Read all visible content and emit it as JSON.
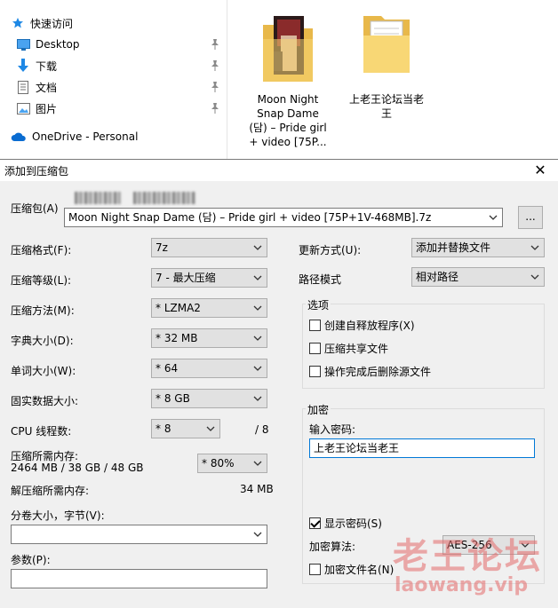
{
  "explorer": {
    "nav": [
      {
        "label": "快速访问",
        "icon": "star-icon"
      },
      {
        "label": "Desktop",
        "icon": "desktop-icon"
      },
      {
        "label": "下载",
        "icon": "download-icon"
      },
      {
        "label": "文档",
        "icon": "document-icon"
      },
      {
        "label": "图片",
        "icon": "picture-icon"
      },
      {
        "label": "OneDrive - Personal",
        "icon": "cloud-icon"
      }
    ],
    "files": [
      {
        "name": "Moon Night Snap  Dame (담) – Pride girl + video [75P...",
        "icon": "folder-with-photo-icon"
      },
      {
        "name": "上老王论坛当老王",
        "icon": "folder-icon"
      }
    ]
  },
  "dialog": {
    "title": "添加到压缩包",
    "archive_label": "压缩包(A)",
    "archive_value": "Moon Night Snap  Dame (담) – Pride girl + video [75P+1V-468MB].7z",
    "browse_label": "...",
    "left": [
      {
        "label": "压缩格式(F):",
        "value": "7z"
      },
      {
        "label": "压缩等级(L):",
        "value": "7 - 最大压缩"
      },
      {
        "label": "压缩方法(M):",
        "value": "* LZMA2"
      },
      {
        "label": "字典大小(D):",
        "value": "* 32 MB"
      },
      {
        "label": "单词大小(W):",
        "value": "* 64"
      },
      {
        "label": "固实数据大小:",
        "value": "* 8 GB"
      }
    ],
    "cpu_label": "CPU 线程数:",
    "cpu_value": "* 8",
    "cpu_max": "/ 8",
    "mem_label": "压缩所需内存:",
    "mem_detail": "2464 MB / 38 GB / 48 GB",
    "mem_value": "* 80%",
    "decomp_label": "解压缩所需内存:",
    "decomp_value": "34 MB",
    "volume_label": "分卷大小，字节(V):",
    "volume_value": "",
    "params_label": "参数(P):",
    "params_value": "",
    "update_label": "更新方式(U):",
    "update_value": "添加并替换文件",
    "path_label": "路径模式",
    "path_value": "相对路径",
    "options_title": "选项",
    "options": [
      {
        "label": "创建自释放程序(X)",
        "checked": false
      },
      {
        "label": "压缩共享文件",
        "checked": false
      },
      {
        "label": "操作完成后删除源文件",
        "checked": false
      }
    ],
    "encrypt_title": "加密",
    "password_label": "输入密码:",
    "password_value": "上老王论坛当老王",
    "show_password_label": "显示密码(S)",
    "show_password_checked": true,
    "method_label": "加密算法:",
    "method_value": "AES-256",
    "encrypt_names_label": "加密文件名(N)",
    "encrypt_names_checked": false
  },
  "watermark": {
    "cn": "老王论坛",
    "en": "laowang.vip"
  },
  "colors": {
    "dialog_bg": "#f0f0f0",
    "accent_blue": "#0078d7",
    "folder_yellow": "#f8d775",
    "watermark_red": "#e56a6a"
  }
}
